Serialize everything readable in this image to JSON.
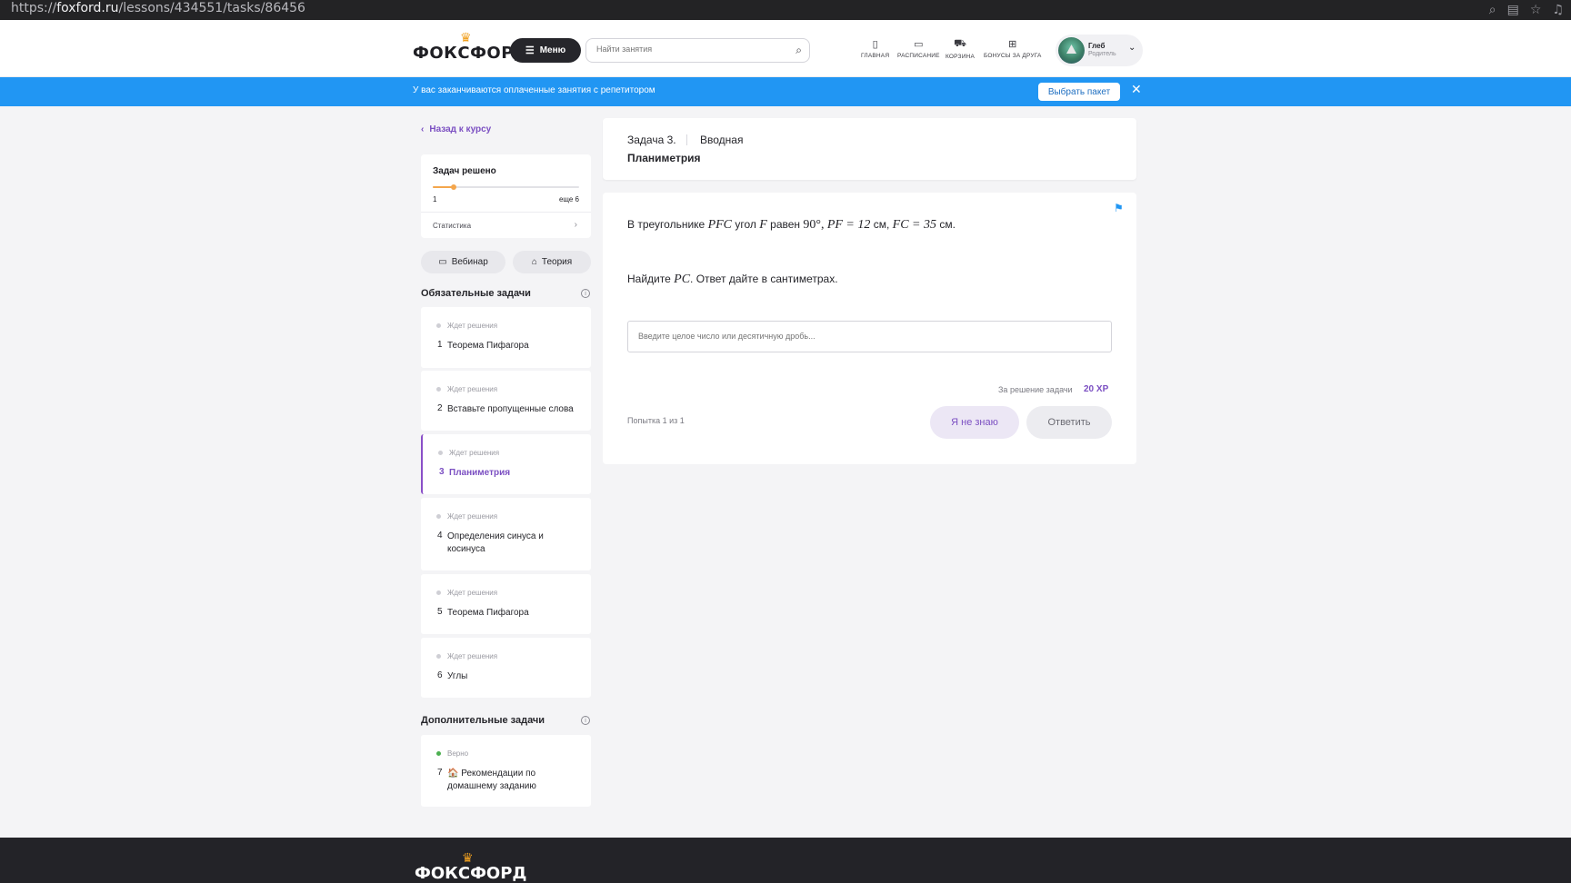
{
  "browser": {
    "url_prefix": "https://",
    "url_domain": "foxford.ru",
    "url_path": "/lessons/434551/tasks/86456"
  },
  "header": {
    "logo": "ФОКСФОРД",
    "menu_label": "Меню",
    "search_placeholder": "Найти занятия",
    "nav": [
      {
        "label": "Главная",
        "icon": "home-icon"
      },
      {
        "label": "Расписание",
        "icon": "calendar-icon"
      },
      {
        "label": "Корзина",
        "icon": "cart-icon"
      },
      {
        "label": "Бонусы за друга",
        "icon": "gift-icon"
      }
    ],
    "profile": {
      "name": "Глеб",
      "role": "Родитель"
    }
  },
  "banner": {
    "text": "У вас заканчиваются оплаченные занятия с репетитором",
    "button": "Выбрать пакет",
    "color": "#2196f3"
  },
  "sidebar": {
    "back_label": "Назад к курсу",
    "stats": {
      "title": "Задач решено",
      "solved": "1",
      "remaining": "еще 6",
      "progress": 0.14,
      "link": "Статистика"
    },
    "webinar_label": "Вебинар",
    "theory_label": "Теория",
    "required_title": "Обязательные задачи",
    "required_tasks": [
      {
        "num": "1",
        "status": "Ждет решения",
        "title": "Теорема Пифагора"
      },
      {
        "num": "2",
        "status": "Ждет решения",
        "title": "Вставьте пропущенные слова"
      },
      {
        "num": "3",
        "status": "Ждет решения",
        "title": "Планиметрия"
      },
      {
        "num": "4",
        "status": "Ждет решения",
        "title": "Определения синуса и косинуса"
      },
      {
        "num": "5",
        "status": "Ждет решения",
        "title": "Теорема Пифагора"
      },
      {
        "num": "6",
        "status": "Ждет решения",
        "title": "Углы"
      }
    ],
    "extra_title": "Дополнительные задачи",
    "extra_tasks": [
      {
        "num": "7",
        "status": "Верно",
        "title": "🏠 Рекомендации по домашнему заданию"
      }
    ]
  },
  "task": {
    "number": "Задача 3.",
    "type": "Вводная",
    "title": "Планиметрия",
    "q1": {
      "t1": "В треугольнике",
      "v1": "PFC",
      "t2": "угол",
      "v2": "F",
      "t3": "равен",
      "angle": "90°,",
      "eq1": "PF = 12",
      "t4": "см,",
      "eq2": "FC = 35",
      "t5": "см."
    },
    "q2": {
      "t1": "Найдите",
      "v1": "PC",
      "t2": ". Ответ дайте в сантиметрах."
    },
    "answer_placeholder": "Введите целое число или десятичную дробь...",
    "xp_label": "За решение задачи",
    "xp_value": "20 XP",
    "attempt": "Попытка 1 из 1",
    "dont_know": "Я не знаю",
    "submit": "Ответить"
  },
  "footer": {
    "logo": "ФОКСФОРД"
  },
  "colors": {
    "accent": "#7b4fc2",
    "progress": "#f4a64c"
  }
}
